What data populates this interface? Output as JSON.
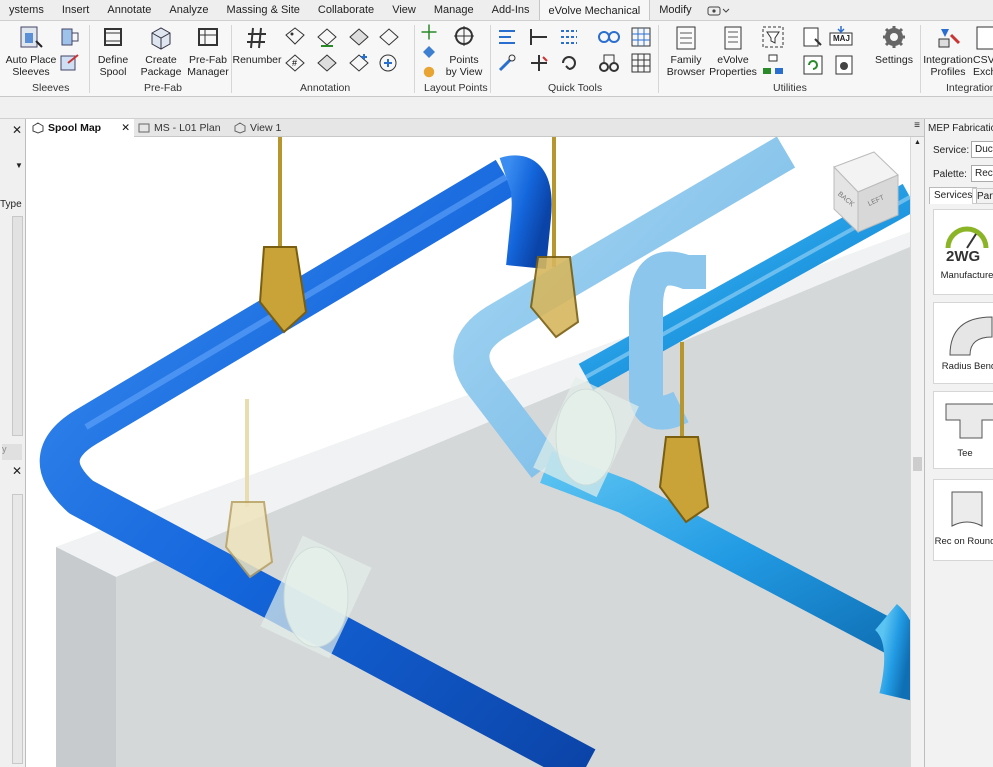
{
  "menu": {
    "tabs": [
      {
        "label": "ystems"
      },
      {
        "label": "Insert"
      },
      {
        "label": "Annotate"
      },
      {
        "label": "Analyze"
      },
      {
        "label": "Massing & Site"
      },
      {
        "label": "Collaborate"
      },
      {
        "label": "View"
      },
      {
        "label": "Manage"
      },
      {
        "label": "Add-Ins"
      },
      {
        "label": "eVolve Mechanical"
      },
      {
        "label": "Modify"
      }
    ],
    "active_tab": "eVolve Mechanical"
  },
  "ribbon": {
    "sleeves": {
      "label": "Sleeves",
      "auto_place": "Auto Place",
      "auto_place2": "Sleeves"
    },
    "prefab": {
      "label": "Pre-Fab",
      "define": "Define",
      "define2": "Spool",
      "create": "Create",
      "create2": "Package",
      "manager": "Pre-Fab",
      "manager2": "Manager"
    },
    "annotation": {
      "label": "Annotation",
      "renumber": "Renumber"
    },
    "layout": {
      "label": "Layout Points",
      "points": "Points",
      "points2": "by View"
    },
    "quick": {
      "label": "Quick Tools"
    },
    "utilities": {
      "label": "Utilities",
      "family": "Family",
      "family2": "Browser",
      "properties": "eVolve",
      "properties2": "Properties",
      "settings": "Settings",
      "maj": "MAJ"
    },
    "integrations": {
      "label": "Integrations",
      "profiles": "Integration",
      "profiles2": "Profiles",
      "csv": "CSV",
      "csv2": "Exch"
    }
  },
  "views": {
    "tabs": [
      {
        "label": "Spool Map",
        "active": true
      },
      {
        "label": "MS - L01 Plan",
        "active": false
      },
      {
        "label": "View 1",
        "active": false
      }
    ]
  },
  "left_panel": {
    "type_label": "Type",
    "y_label": "y"
  },
  "viewcube": {
    "back": "BACK",
    "left": "LEFT"
  },
  "right_panel": {
    "title": "MEP Fabrication",
    "service_label": "Service:",
    "service_value": "Duct",
    "palette_label": "Palette:",
    "palette_value": "Recta",
    "tabs": [
      {
        "label": "Services"
      },
      {
        "label": "Parts"
      }
    ],
    "items": [
      {
        "label": "Manufacture",
        "logo": "2WG"
      },
      {
        "label": "Radius Bend"
      },
      {
        "label": "Tee"
      },
      {
        "label": "Rec on Round"
      }
    ]
  },
  "colors": {
    "pipe_blue": "#1468e0",
    "pipe_cyan": "#2a9fe6",
    "hanger_gold": "#c9a238",
    "wall_gray": "#c4c8ca"
  }
}
